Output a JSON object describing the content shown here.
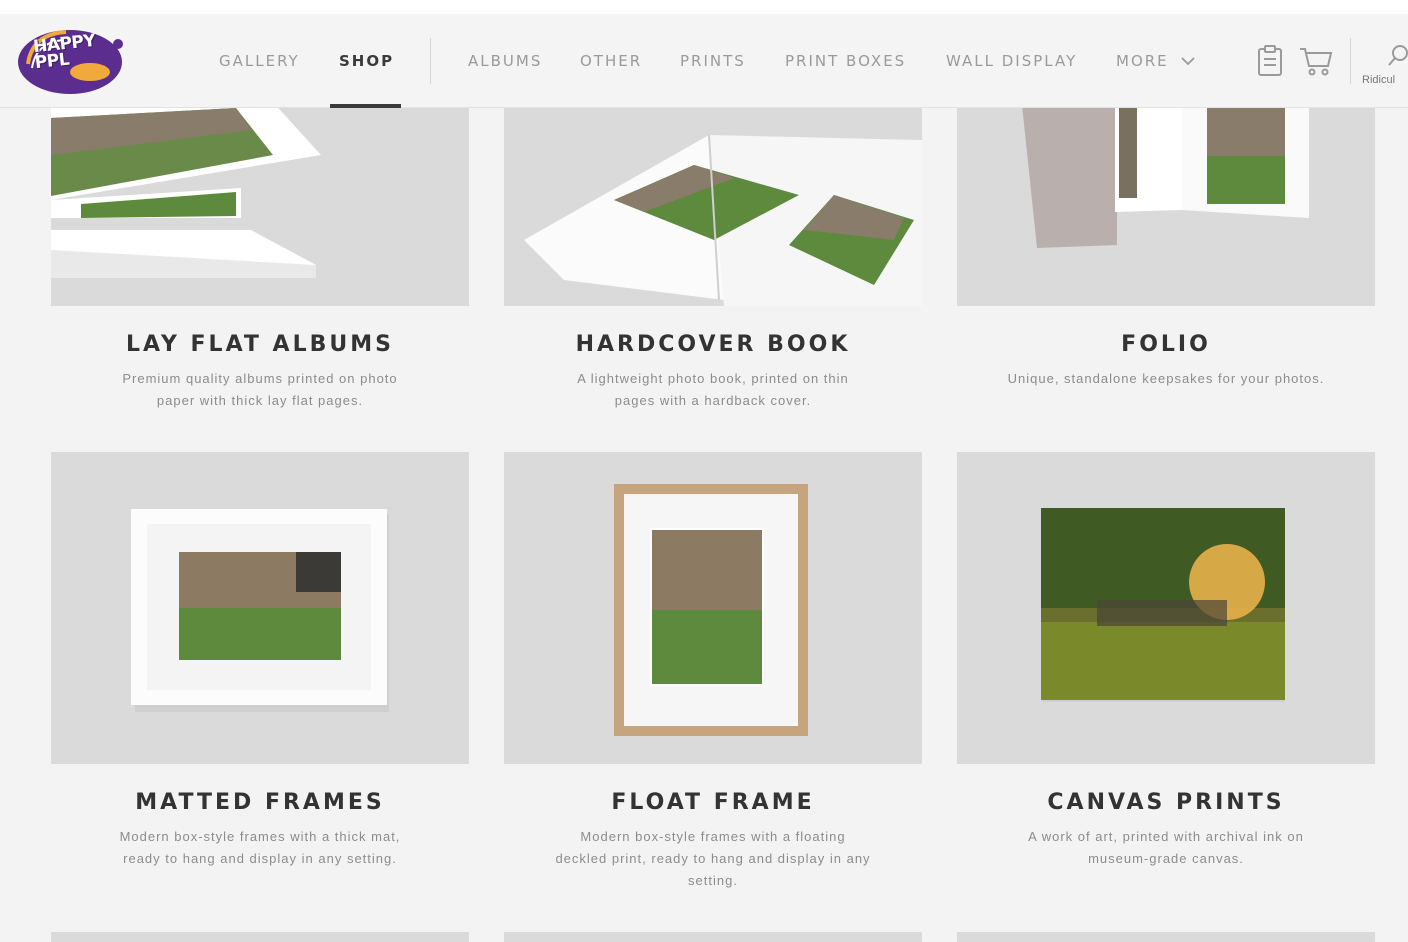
{
  "header": {
    "logo_text_line1": "HAPPY",
    "logo_text_line2": "PPL",
    "logo_sub": "",
    "nav_primary": [
      "GALLERY",
      "SHOP"
    ],
    "nav_secondary": [
      "ALBUMS",
      "OTHER",
      "PRINTS",
      "PRINT BOXES",
      "WALL DISPLAY",
      "MORE"
    ],
    "active_nav": "SHOP",
    "search_label": "Ridicul"
  },
  "products": [
    {
      "title": "LAY FLAT ALBUMS",
      "description_line1": "Premium quality albums printed on photo",
      "description_line2": "paper with thick lay flat pages.",
      "description_line3": ""
    },
    {
      "title": "HARDCOVER BOOK",
      "description_line1": "A lightweight photo book, printed on thin",
      "description_line2": "pages with a hardback cover.",
      "description_line3": ""
    },
    {
      "title": "FOLIO",
      "description_line1": "Unique, standalone keepsakes for your photos.",
      "description_line2": "",
      "description_line3": ""
    },
    {
      "title": "MATTED FRAMES",
      "description_line1": "Modern box-style frames with a thick mat,",
      "description_line2": "ready to hang and display in any setting.",
      "description_line3": ""
    },
    {
      "title": "FLOAT FRAME",
      "description_line1": "Modern box-style frames with a floating",
      "description_line2": "deckled print, ready to hang and display in any",
      "description_line3": "setting."
    },
    {
      "title": "CANVAS PRINTS",
      "description_line1": "A work of art, printed with archival ink on",
      "description_line2": "museum-grade canvas.",
      "description_line3": ""
    }
  ],
  "colors": {
    "accent": "#3a3a3a",
    "logo_purple": "#5b2d8e",
    "logo_orange": "#f2a93b",
    "card_bg": "#dadada"
  }
}
